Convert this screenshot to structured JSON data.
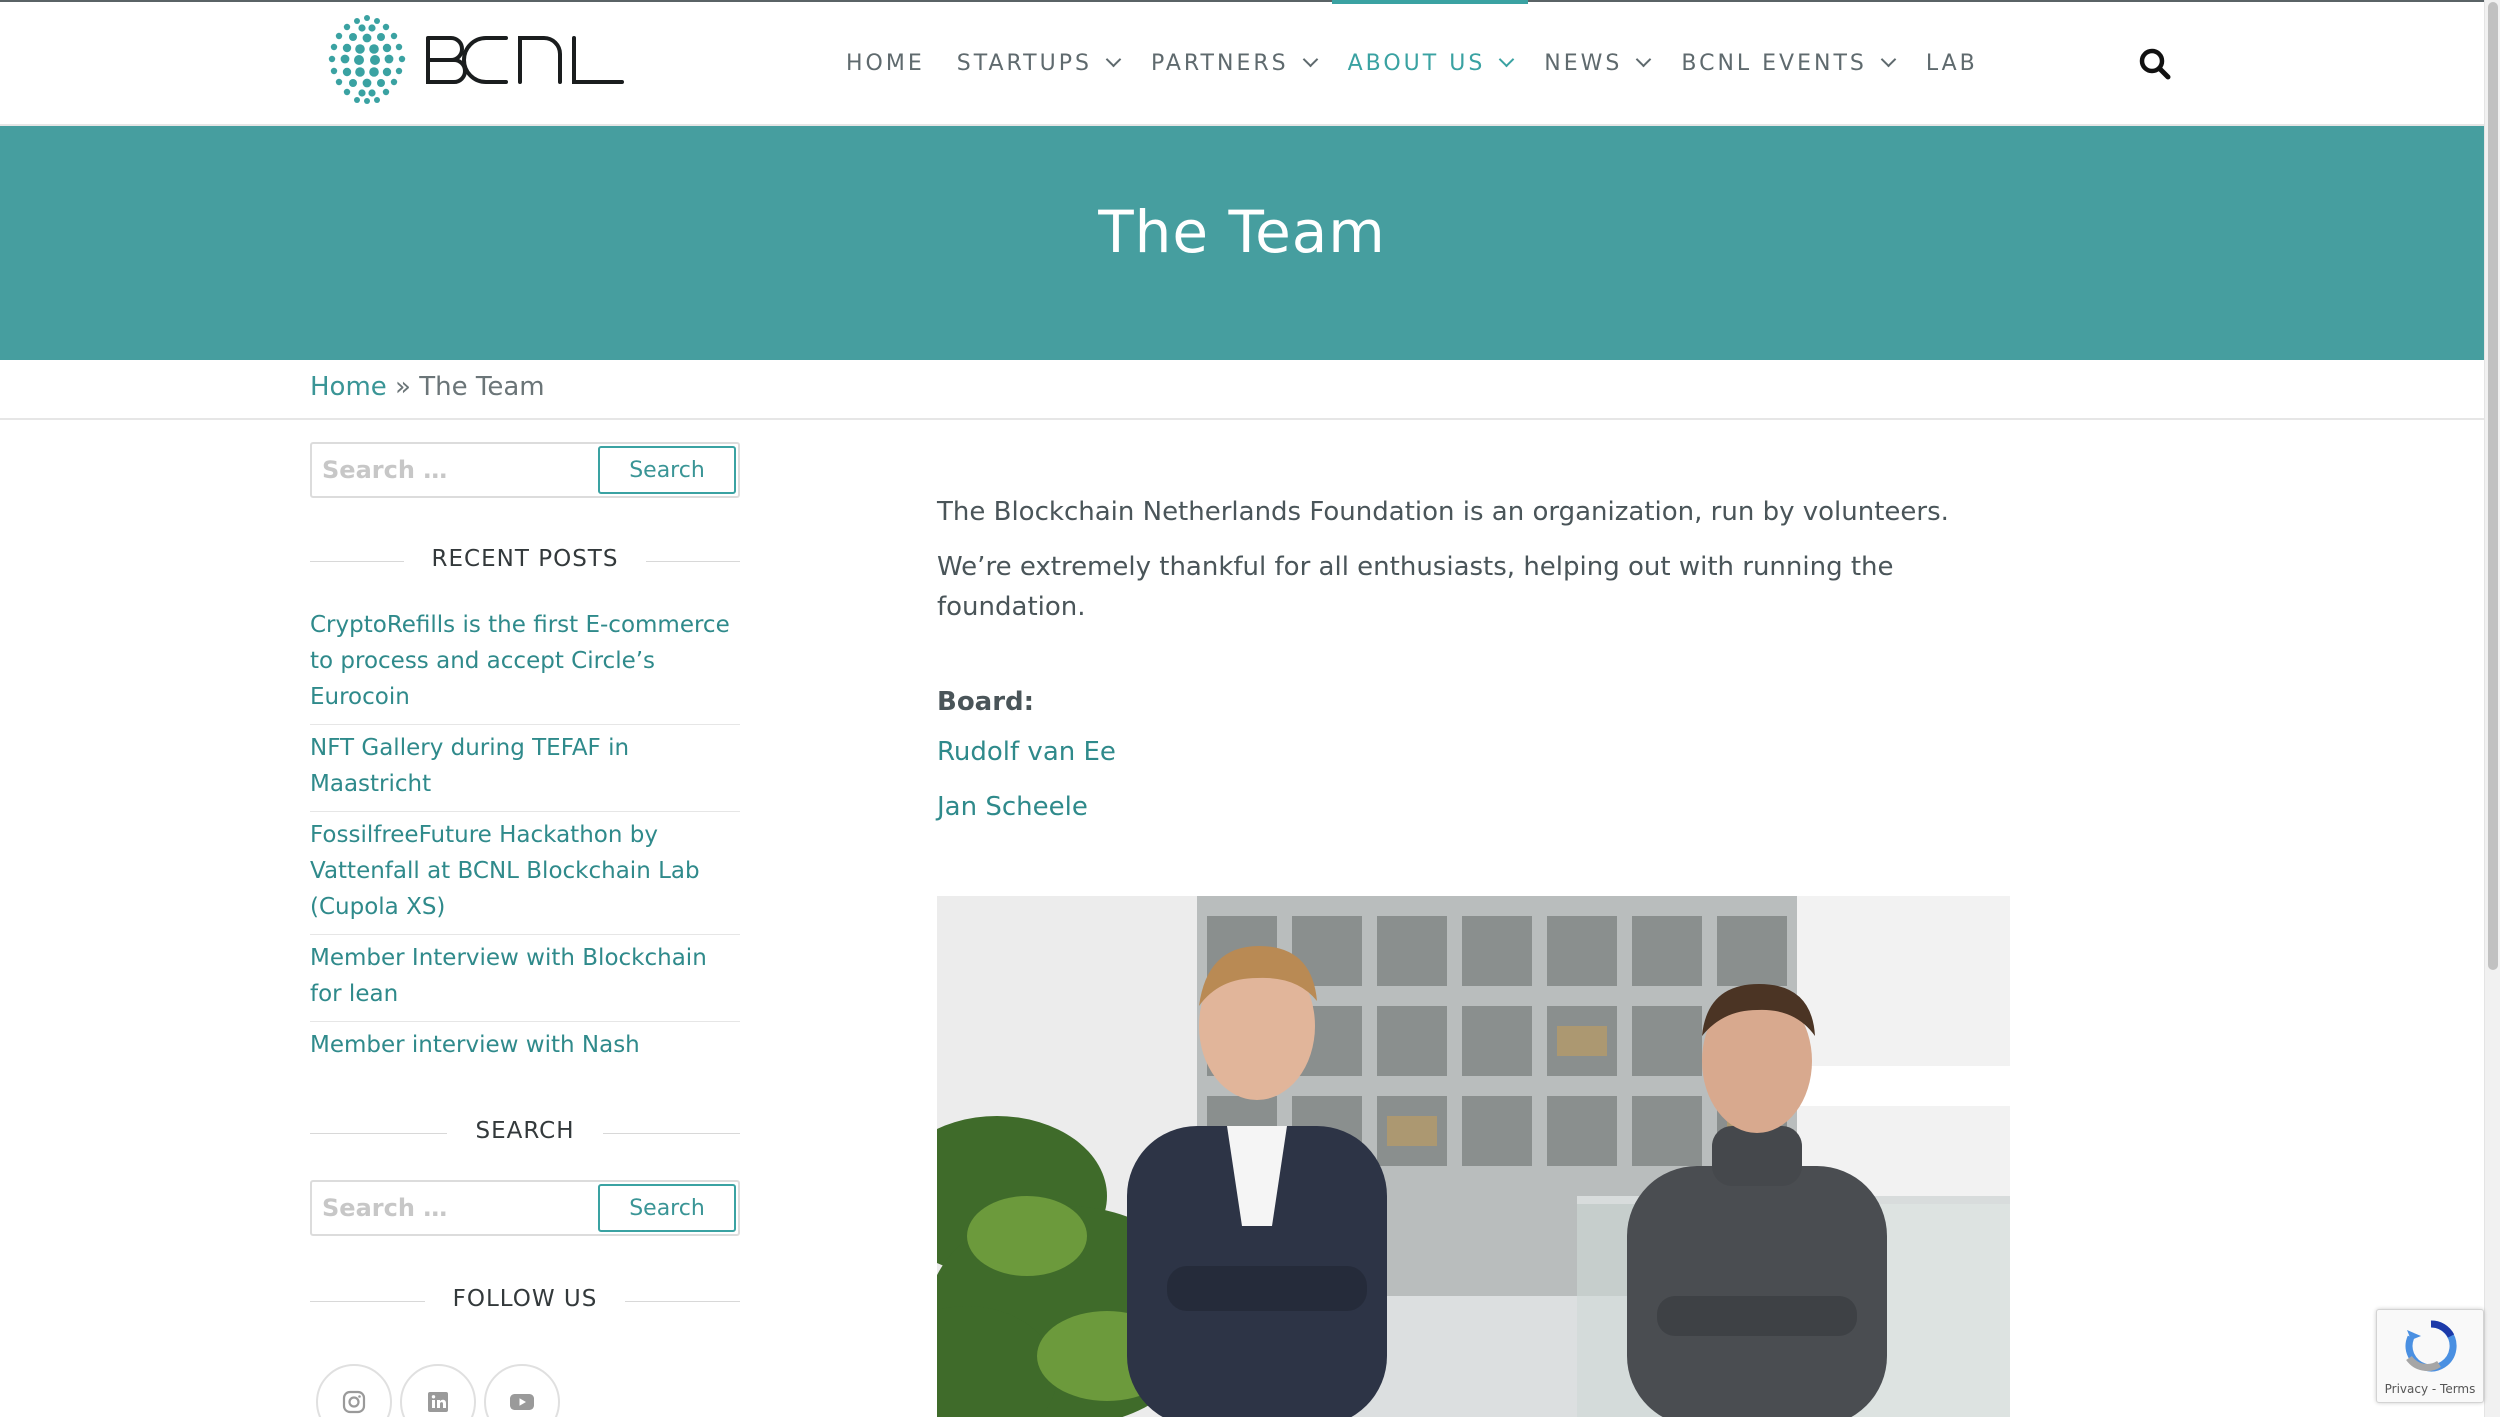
{
  "site": {
    "logo_text": "BCNL",
    "brand_color": "#469e9f"
  },
  "nav": {
    "items": [
      {
        "label": "HOME",
        "dropdown": false,
        "active": false
      },
      {
        "label": "STARTUPS",
        "dropdown": true,
        "active": false
      },
      {
        "label": "PARTNERS",
        "dropdown": true,
        "active": false
      },
      {
        "label": "ABOUT US",
        "dropdown": true,
        "active": true
      },
      {
        "label": "NEWS",
        "dropdown": true,
        "active": false
      },
      {
        "label": "BCNL EVENTS",
        "dropdown": true,
        "active": false
      },
      {
        "label": "LAB",
        "dropdown": false,
        "active": false
      }
    ],
    "search_icon": "search-icon"
  },
  "hero": {
    "title": "The Team"
  },
  "breadcrumb": {
    "home": "Home",
    "separator": "»",
    "current": "The Team"
  },
  "sidebar": {
    "search": {
      "placeholder": "Search …",
      "button": "Search"
    },
    "recent_posts_title": "RECENT POSTS",
    "recent_posts": [
      "CryptoRefills is the first E-commerce to process and accept Circle’s Eurocoin",
      "NFT Gallery during TEFAF in Maastricht",
      "FossilfreeFuture Hackathon by Vattenfall at BCNL Blockchain Lab (Cupola XS)",
      "Member Interview with Blockchain for lean",
      "Member interview with Nash"
    ],
    "search_title": "SEARCH",
    "search2": {
      "placeholder": "Search …",
      "button": "Search"
    },
    "follow_title": "FOLLOW US",
    "socials": [
      "instagram-icon",
      "linkedin-icon",
      "youtube-icon"
    ]
  },
  "main": {
    "intro": "The Blockchain Netherlands Foundation is an organization, run by volunteers.",
    "thanks": "We’re extremely thankful for all enthusiasts, helping out with running the foundation.",
    "board_label": "Board:",
    "board_members": [
      "Rudolf van Ee",
      "Jan Scheele"
    ]
  },
  "recaptcha": {
    "terms": "Privacy - Terms"
  }
}
